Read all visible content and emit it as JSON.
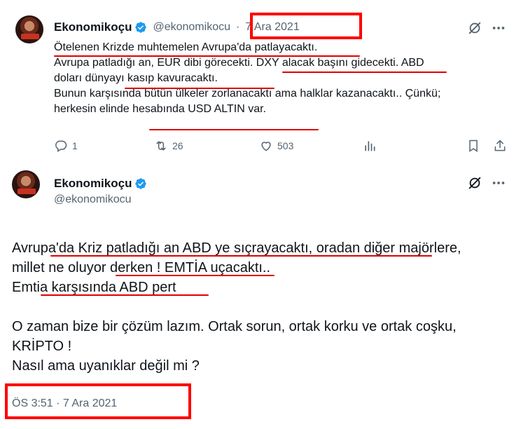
{
  "tweet1": {
    "author_name": "Ekonomikoçu",
    "handle": "@ekonomikocu",
    "separator": "·",
    "date": "7 Ara 2021",
    "lines": [
      "Ötelenen Krizde muhtemelen Avrupa'da patlayacaktı.",
      "Avrupa patladığı an, EUR dibi görecekti. DXY alacak başını gidecekti. ABD",
      "doları dünyayı kasıp kavuracaktı.",
      "Bunun karşısında bütün ülkeler zorlanacaktı ama halklar kazanacaktı.. Çünkü;",
      "herkesin elinde hesabında USD ALTIN var."
    ],
    "actions": {
      "reply_count": "1",
      "retweet_count": "26",
      "like_count": "503"
    }
  },
  "tweet2": {
    "author_name": "Ekonomikoçu",
    "handle": "@ekonomikocu",
    "lines": [
      "Avrupa'da Kriz patladığı an ABD ye sıçrayacaktı, oradan diğer majörlere,",
      "millet ne oluyor derken ! EMTİA uçacaktı..",
      "Emtia karşısında ABD pert",
      "",
      "O zaman bize bir çözüm lazım.  Ortak sorun, ortak korku ve ortak coşku,",
      "KRİPTO !",
      "Nasıl ama uyanıklar değil mi ?"
    ],
    "timestamp": "ÖS 3:51 · 7 Ara 2021"
  },
  "colors": {
    "verified_blue": "#1d9bf0",
    "secondary_text": "#536471",
    "annotation_red": "#ff0000"
  },
  "icons": [
    "grok-icon",
    "more-icon",
    "reply-icon",
    "retweet-icon",
    "like-icon",
    "views-icon",
    "bookmark-icon",
    "share-icon",
    "verified-icon"
  ]
}
